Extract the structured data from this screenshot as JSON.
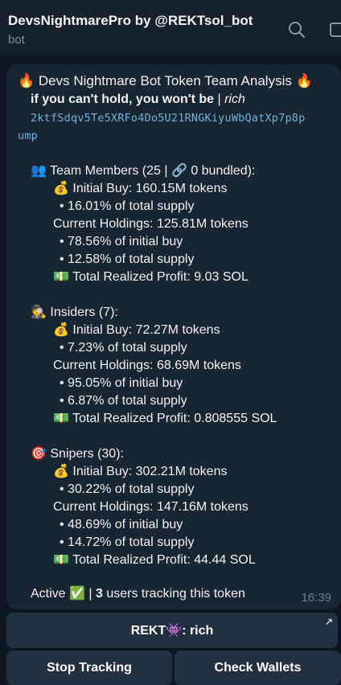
{
  "header": {
    "title": "DevsNightmarePro by @REKTsol_bot",
    "subtitle": "bot",
    "icons": [
      "search-icon",
      "panel-icon"
    ]
  },
  "message": {
    "heading": "🔥 Devs Nightmare Bot Token Team Analysis 🔥",
    "tagline_bold": "if you can't hold, you won't be",
    "tagline_sep": " | ",
    "tagline_italic": "rich",
    "address_line1": "2ktfSdqv5Te5XRFo4Do5U21RNGKiyuWbQatXp7p8p",
    "address_line2": "ump",
    "team": {
      "title": "👥 Team Members (25 | 🔗 0 bundled):",
      "initial_buy": "💰 Initial Buy: 160.15M tokens",
      "initial_pct": "• 16.01% of total supply",
      "current": "Current Holdings: 125.81M tokens",
      "current_pct_initial": "• 78.56% of initial buy",
      "current_pct_total": "• 12.58% of total supply",
      "profit": "💵 Total Realized Profit: 9.03 SOL"
    },
    "insiders": {
      "title": "🕵️ Insiders (7):",
      "initial_buy": "💰 Initial Buy: 72.27M tokens",
      "initial_pct": "• 7.23% of total supply",
      "current": "Current Holdings: 68.69M tokens",
      "current_pct_initial": "• 95.05% of initial buy",
      "current_pct_total": "• 6.87% of total supply",
      "profit": "💵 Total Realized Profit: 0.808555 SOL"
    },
    "snipers": {
      "title": "🎯 Snipers (30):",
      "initial_buy": "💰 Initial Buy: 302.21M tokens",
      "initial_pct": "• 30.22% of total supply",
      "current": "Current Holdings: 147.16M tokens",
      "current_pct_initial": "• 48.69% of initial buy",
      "current_pct_total": "• 14.72% of total supply",
      "profit": "💵 Total Realized Profit: 44.44 SOL"
    },
    "status_prefix": "Active ✅ | ",
    "status_count": "3",
    "status_suffix": " users tracking this token",
    "time": "16:39"
  },
  "buttons": {
    "rekt": "REKT👾: rich",
    "rekt_arrow": "↗",
    "stop": "Stop Tracking",
    "check": "Check Wallets"
  },
  "colors": {
    "background": "#0e1621",
    "header": "#17212b",
    "bubble": "#182533",
    "button": "#223041",
    "address": "#6fb1d8"
  }
}
